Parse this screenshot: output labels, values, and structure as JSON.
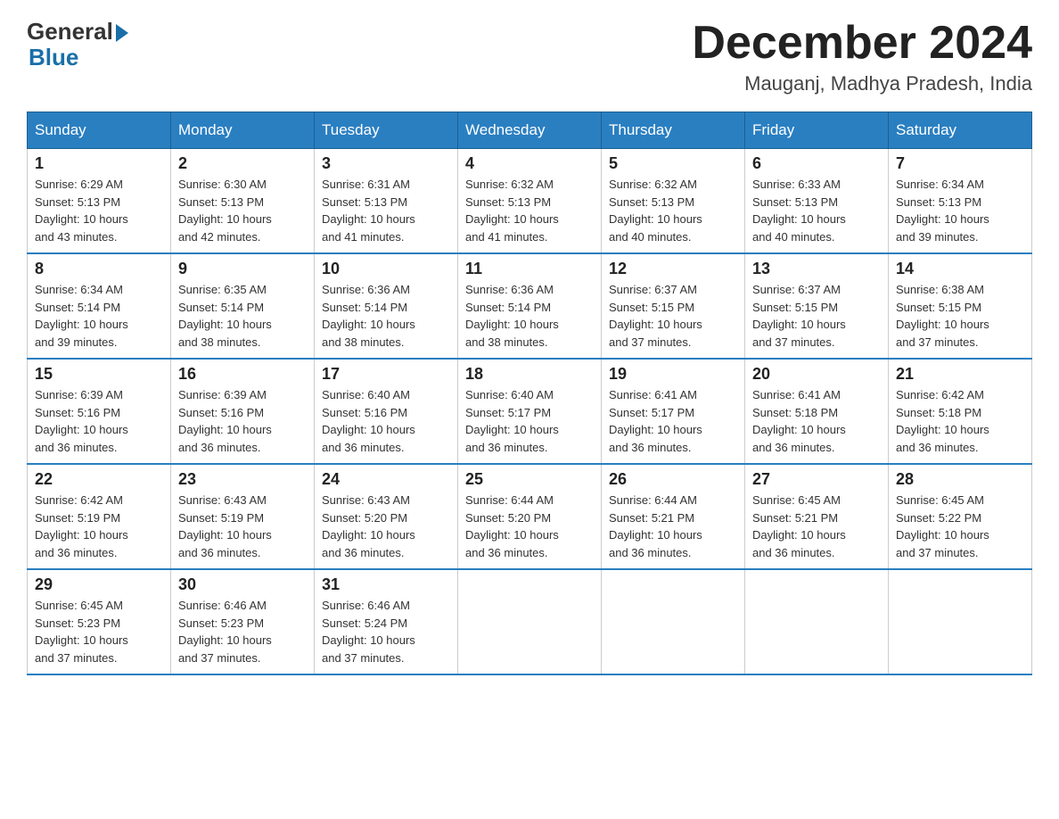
{
  "header": {
    "logo_general": "General",
    "logo_blue": "Blue",
    "month_title": "December 2024",
    "location": "Mauganj, Madhya Pradesh, India"
  },
  "weekdays": [
    "Sunday",
    "Monday",
    "Tuesday",
    "Wednesday",
    "Thursday",
    "Friday",
    "Saturday"
  ],
  "weeks": [
    [
      {
        "day": "1",
        "sunrise": "6:29 AM",
        "sunset": "5:13 PM",
        "daylight": "10 hours and 43 minutes."
      },
      {
        "day": "2",
        "sunrise": "6:30 AM",
        "sunset": "5:13 PM",
        "daylight": "10 hours and 42 minutes."
      },
      {
        "day": "3",
        "sunrise": "6:31 AM",
        "sunset": "5:13 PM",
        "daylight": "10 hours and 41 minutes."
      },
      {
        "day": "4",
        "sunrise": "6:32 AM",
        "sunset": "5:13 PM",
        "daylight": "10 hours and 41 minutes."
      },
      {
        "day": "5",
        "sunrise": "6:32 AM",
        "sunset": "5:13 PM",
        "daylight": "10 hours and 40 minutes."
      },
      {
        "day": "6",
        "sunrise": "6:33 AM",
        "sunset": "5:13 PM",
        "daylight": "10 hours and 40 minutes."
      },
      {
        "day": "7",
        "sunrise": "6:34 AM",
        "sunset": "5:13 PM",
        "daylight": "10 hours and 39 minutes."
      }
    ],
    [
      {
        "day": "8",
        "sunrise": "6:34 AM",
        "sunset": "5:14 PM",
        "daylight": "10 hours and 39 minutes."
      },
      {
        "day": "9",
        "sunrise": "6:35 AM",
        "sunset": "5:14 PM",
        "daylight": "10 hours and 38 minutes."
      },
      {
        "day": "10",
        "sunrise": "6:36 AM",
        "sunset": "5:14 PM",
        "daylight": "10 hours and 38 minutes."
      },
      {
        "day": "11",
        "sunrise": "6:36 AM",
        "sunset": "5:14 PM",
        "daylight": "10 hours and 38 minutes."
      },
      {
        "day": "12",
        "sunrise": "6:37 AM",
        "sunset": "5:15 PM",
        "daylight": "10 hours and 37 minutes."
      },
      {
        "day": "13",
        "sunrise": "6:37 AM",
        "sunset": "5:15 PM",
        "daylight": "10 hours and 37 minutes."
      },
      {
        "day": "14",
        "sunrise": "6:38 AM",
        "sunset": "5:15 PM",
        "daylight": "10 hours and 37 minutes."
      }
    ],
    [
      {
        "day": "15",
        "sunrise": "6:39 AM",
        "sunset": "5:16 PM",
        "daylight": "10 hours and 36 minutes."
      },
      {
        "day": "16",
        "sunrise": "6:39 AM",
        "sunset": "5:16 PM",
        "daylight": "10 hours and 36 minutes."
      },
      {
        "day": "17",
        "sunrise": "6:40 AM",
        "sunset": "5:16 PM",
        "daylight": "10 hours and 36 minutes."
      },
      {
        "day": "18",
        "sunrise": "6:40 AM",
        "sunset": "5:17 PM",
        "daylight": "10 hours and 36 minutes."
      },
      {
        "day": "19",
        "sunrise": "6:41 AM",
        "sunset": "5:17 PM",
        "daylight": "10 hours and 36 minutes."
      },
      {
        "day": "20",
        "sunrise": "6:41 AM",
        "sunset": "5:18 PM",
        "daylight": "10 hours and 36 minutes."
      },
      {
        "day": "21",
        "sunrise": "6:42 AM",
        "sunset": "5:18 PM",
        "daylight": "10 hours and 36 minutes."
      }
    ],
    [
      {
        "day": "22",
        "sunrise": "6:42 AM",
        "sunset": "5:19 PM",
        "daylight": "10 hours and 36 minutes."
      },
      {
        "day": "23",
        "sunrise": "6:43 AM",
        "sunset": "5:19 PM",
        "daylight": "10 hours and 36 minutes."
      },
      {
        "day": "24",
        "sunrise": "6:43 AM",
        "sunset": "5:20 PM",
        "daylight": "10 hours and 36 minutes."
      },
      {
        "day": "25",
        "sunrise": "6:44 AM",
        "sunset": "5:20 PM",
        "daylight": "10 hours and 36 minutes."
      },
      {
        "day": "26",
        "sunrise": "6:44 AM",
        "sunset": "5:21 PM",
        "daylight": "10 hours and 36 minutes."
      },
      {
        "day": "27",
        "sunrise": "6:45 AM",
        "sunset": "5:21 PM",
        "daylight": "10 hours and 36 minutes."
      },
      {
        "day": "28",
        "sunrise": "6:45 AM",
        "sunset": "5:22 PM",
        "daylight": "10 hours and 37 minutes."
      }
    ],
    [
      {
        "day": "29",
        "sunrise": "6:45 AM",
        "sunset": "5:23 PM",
        "daylight": "10 hours and 37 minutes."
      },
      {
        "day": "30",
        "sunrise": "6:46 AM",
        "sunset": "5:23 PM",
        "daylight": "10 hours and 37 minutes."
      },
      {
        "day": "31",
        "sunrise": "6:46 AM",
        "sunset": "5:24 PM",
        "daylight": "10 hours and 37 minutes."
      },
      null,
      null,
      null,
      null
    ]
  ],
  "labels": {
    "sunrise": "Sunrise:",
    "sunset": "Sunset:",
    "daylight": "Daylight:"
  }
}
